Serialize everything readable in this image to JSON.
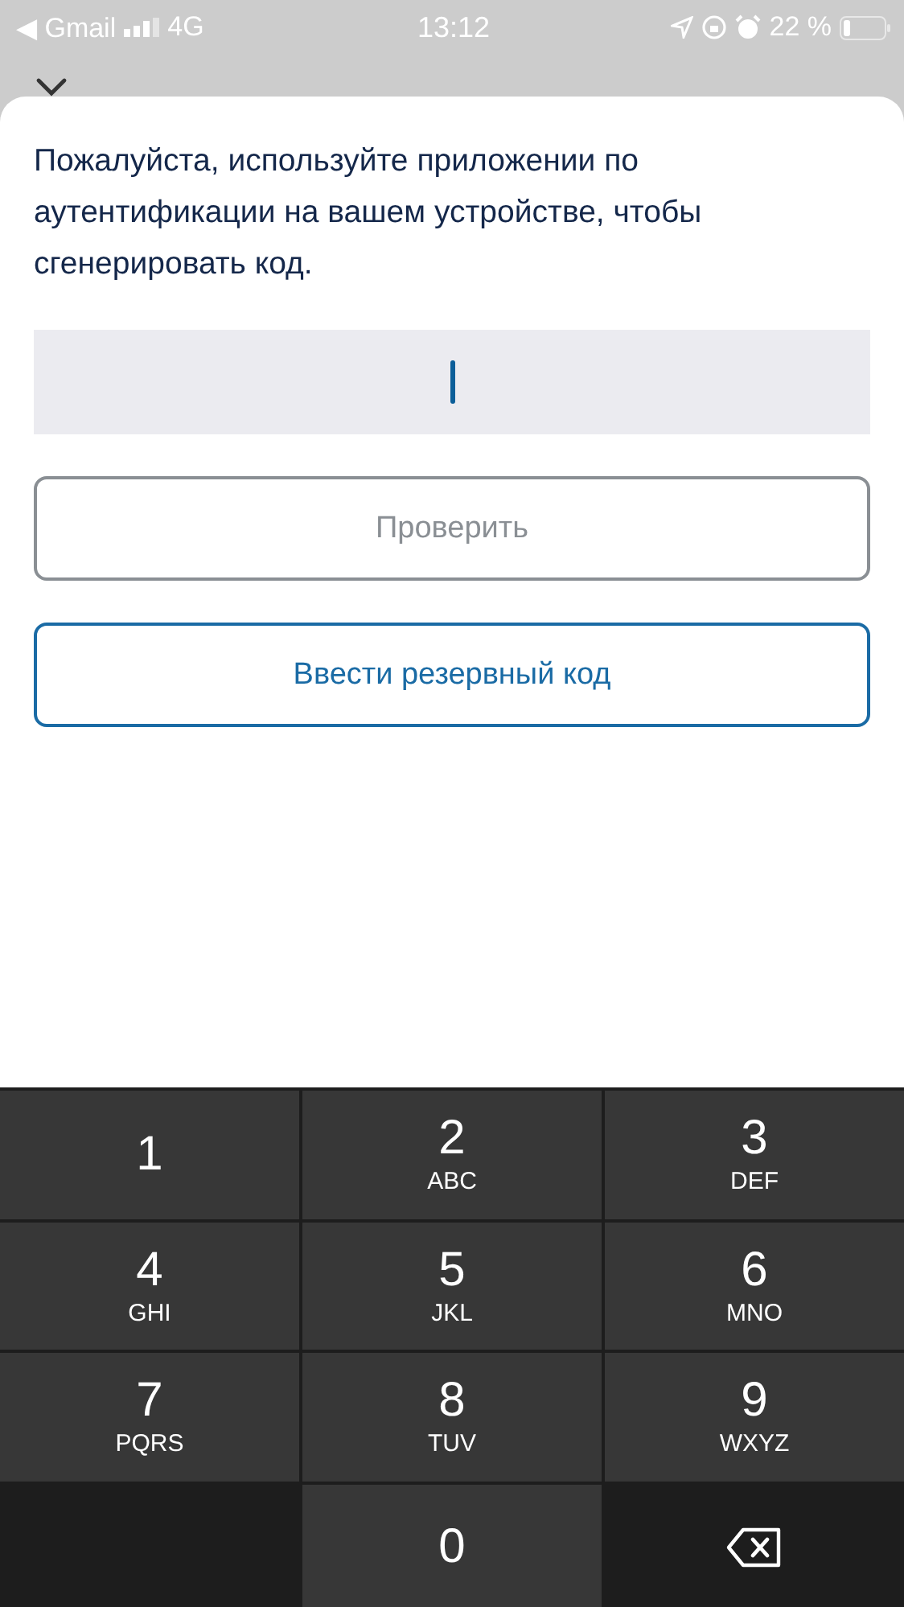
{
  "status_bar": {
    "back_app": "◀ Gmail",
    "network": "4G",
    "time": "13:12",
    "battery_percent": "22 %"
  },
  "message": "Пожалуйста, используйте приложении по аутентификации на вашем устройстве, чтобы сгенерировать код.",
  "code_field": {
    "focused": true
  },
  "buttons": [
    {
      "label": "Проверить",
      "disabled": true
    },
    {
      "label": "Ввести резервный код",
      "disabled": false
    }
  ],
  "keypad": [
    {
      "kind": "digit",
      "digit": "1"
    },
    {
      "kind": "digit",
      "digit": "2",
      "letters": "ABC"
    },
    {
      "kind": "digit",
      "digit": "3",
      "letters": "DEF"
    },
    {
      "kind": "digit",
      "digit": "4",
      "letters": "GHI"
    },
    {
      "kind": "digit",
      "digit": "5",
      "letters": "JKL"
    },
    {
      "kind": "digit",
      "digit": "6",
      "letters": "MNO"
    },
    {
      "kind": "digit",
      "digit": "7",
      "letters": "PQRS"
    },
    {
      "kind": "digit",
      "digit": "8",
      "letters": "TUV"
    },
    {
      "kind": "digit",
      "digit": "9",
      "letters": "WXYZ"
    },
    {
      "kind": "blank"
    },
    {
      "kind": "digit",
      "digit": "0"
    },
    {
      "kind": "delete"
    }
  ]
}
